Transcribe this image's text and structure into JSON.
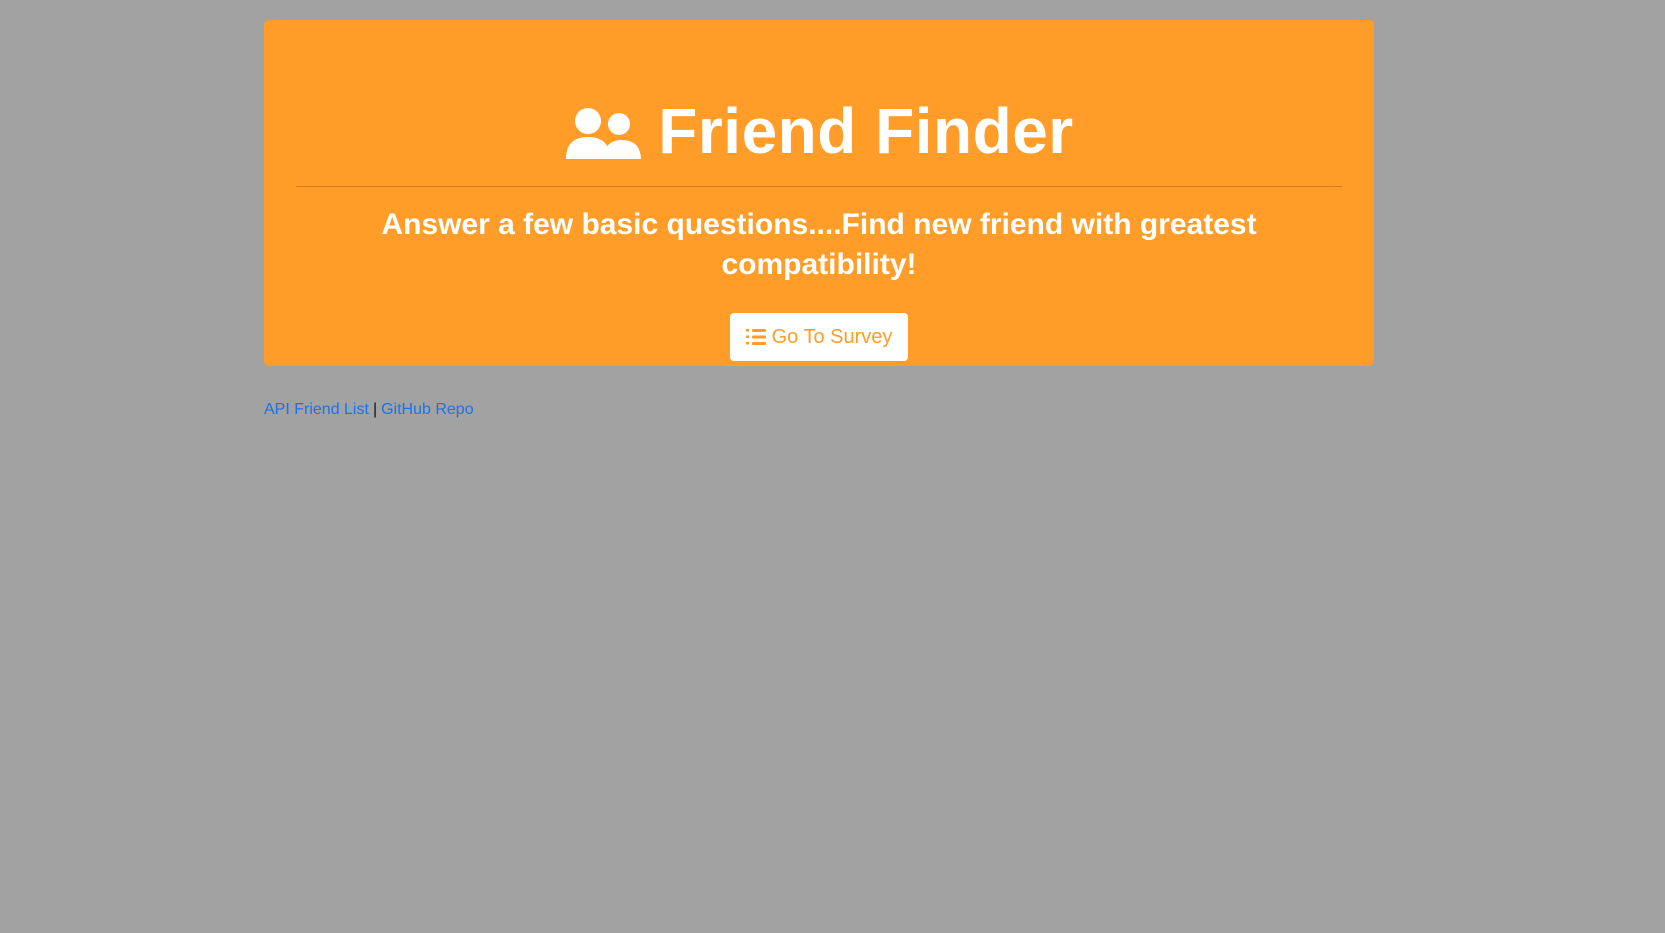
{
  "header": {
    "title": "Friend Finder",
    "icon": "user-friends-icon"
  },
  "subtitle": "Answer a few basic questions....Find new friend with greatest compatibility!",
  "survey_button": {
    "label": "Go To Survey",
    "icon": "list-ol-icon"
  },
  "footer": {
    "api_link": "API Friend List",
    "separator": "|",
    "github_link": "GitHub Repo"
  },
  "colors": {
    "background": "#a2a2a2",
    "accent": "#ff9d28",
    "link": "#1a73e8",
    "text_on_accent": "#ffffff"
  }
}
